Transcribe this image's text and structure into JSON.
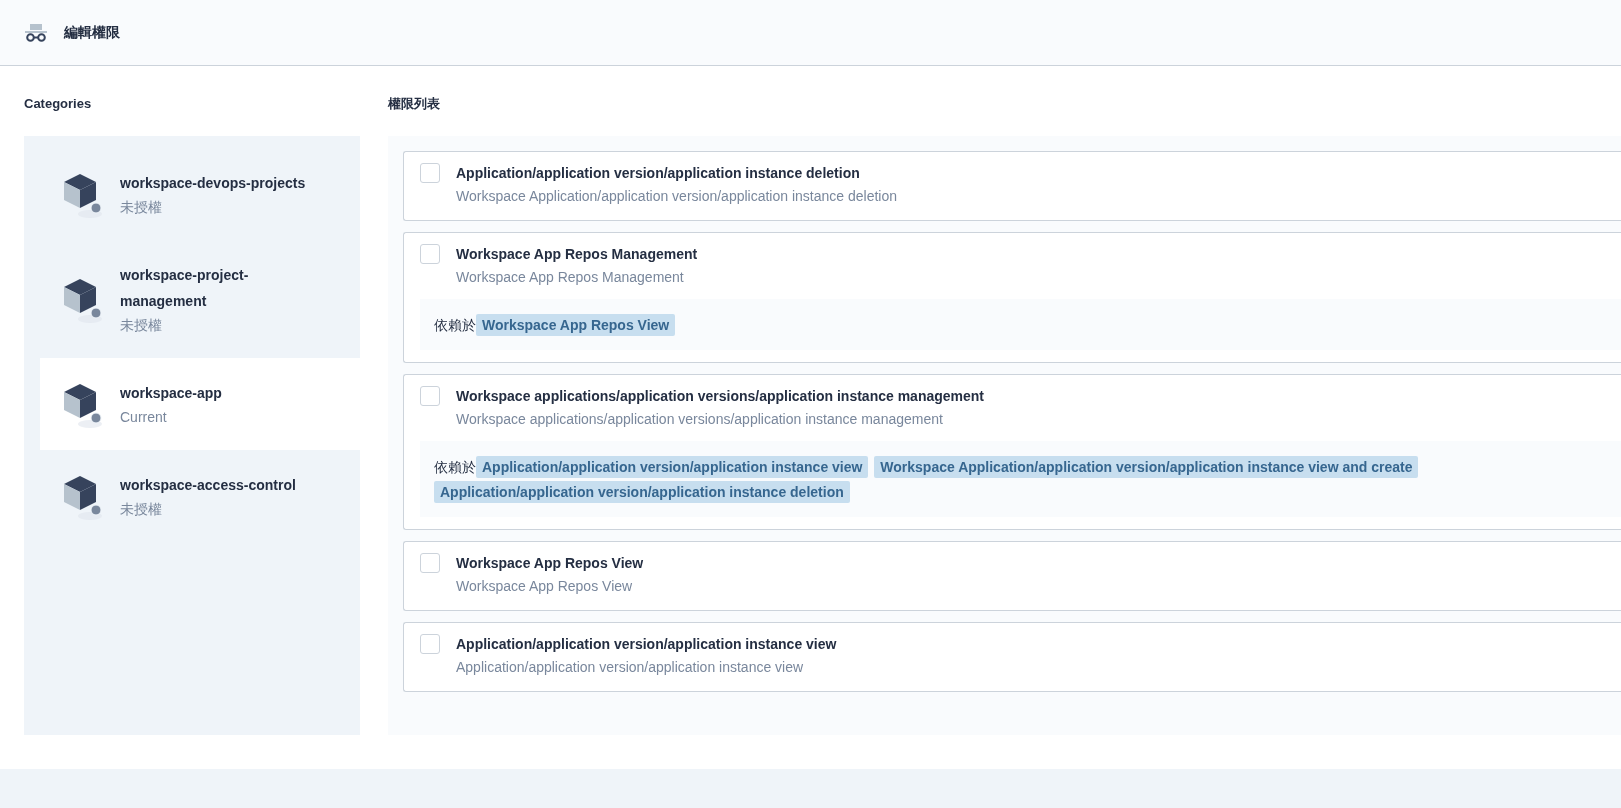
{
  "header": {
    "title": "編輯權限"
  },
  "categories": {
    "title": "Categories",
    "items": [
      {
        "name": "workspace-devops-projects",
        "status": "未授權",
        "selected": false
      },
      {
        "name": "workspace-project-management",
        "status": "未授權",
        "selected": false
      },
      {
        "name": "workspace-app",
        "status": "Current",
        "selected": true
      },
      {
        "name": "workspace-access-control",
        "status": "未授權",
        "selected": false
      }
    ]
  },
  "permissions": {
    "title": "權限列表",
    "items": [
      {
        "title": "Application/application version/application instance deletion",
        "description": "Workspace Application/application version/application instance deletion",
        "checked": false
      },
      {
        "title": "Workspace App Repos Management",
        "description": "Workspace App Repos Management",
        "checked": false,
        "depends_label": "依賴於",
        "depends_on": [
          "Workspace App Repos View"
        ]
      },
      {
        "title": "Workspace applications/application versions/application instance management",
        "description": "Workspace applications/application versions/application instance management",
        "checked": false,
        "depends_label": "依賴於",
        "depends_on": [
          "Application/application version/application instance view",
          "Workspace Application/application version/application instance view and create",
          "Application/application version/application instance deletion"
        ]
      },
      {
        "title": "Workspace App Repos View",
        "description": "Workspace App Repos View",
        "checked": false
      },
      {
        "title": "Application/application version/application instance view",
        "description": "Application/application version/application instance view",
        "checked": false
      }
    ]
  }
}
